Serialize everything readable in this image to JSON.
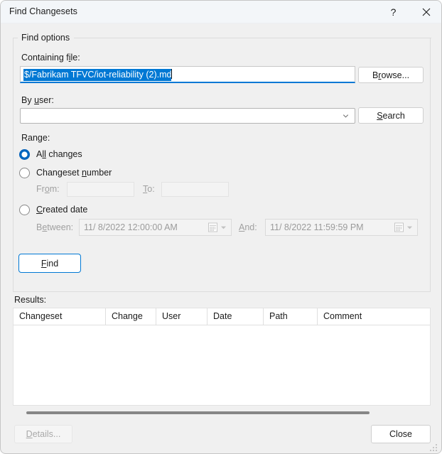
{
  "window": {
    "title": "Find Changesets",
    "help_icon": "question-mark-icon",
    "close_icon": "close-x-icon"
  },
  "find_options": {
    "group_label": "Find options",
    "containing_file": {
      "label": "Containing f",
      "label_accel": "i",
      "label_tail": "le:",
      "value": "$/Fabrikam TFVC/iot-reliability (2).md",
      "selected": true,
      "browse_button": {
        "pre": "B",
        "accel": "r",
        "post": "owse..."
      }
    },
    "by_user": {
      "label_pre": "By ",
      "label_accel": "u",
      "label_post": "ser:",
      "value": "",
      "placeholder": "",
      "dropdown_icon": "chevron-down-icon",
      "search_button": {
        "pre": "",
        "accel": "S",
        "post": "earch"
      }
    },
    "range": {
      "label": "Range:",
      "options": [
        {
          "pre": "A",
          "accel": "ll",
          "post": " changes",
          "checked": true
        },
        {
          "pre": "Changeset ",
          "accel": "n",
          "post": "umber",
          "checked": false
        },
        {
          "pre": "",
          "accel": "C",
          "post": "reated date",
          "checked": false
        }
      ],
      "changeset_number": {
        "from_label_pre": "Fr",
        "from_label_accel": "o",
        "from_label_post": "m:",
        "from_value": "",
        "to_label_pre": "",
        "to_label_accel": "T",
        "to_label_post": "o:",
        "to_value": "",
        "enabled": false
      },
      "created_date": {
        "between_label_pre": "B",
        "between_label_accel": "e",
        "between_label_post": "tween:",
        "between_value": "11/  8/2022 12:00:00 AM",
        "and_label_pre": "",
        "and_label_accel": "A",
        "and_label_post": "nd:",
        "and_value": "11/  8/2022 11:59:59 PM",
        "calendar_icon": "calendar-icon",
        "dropdown_icon": "caret-down-icon",
        "enabled": false
      }
    },
    "find_button": {
      "pre": "",
      "accel": "F",
      "post": "ind"
    }
  },
  "results": {
    "label": "Results:",
    "columns": [
      "Changeset",
      "Change",
      "User",
      "Date",
      "Path",
      "Comment"
    ],
    "rows": [],
    "scrollbar": "horizontal-scrollbar"
  },
  "footer": {
    "details_button": {
      "pre": "",
      "accel": "D",
      "post": "etails..."
    },
    "details_enabled": false,
    "close_button": "Close"
  },
  "colors": {
    "accent": "#0078d4",
    "selection": "#0078d4",
    "radio_checked": "#0067c0",
    "dialog_bg": "#f0f0f0",
    "titlebar_bg": "#f3f6f9"
  }
}
